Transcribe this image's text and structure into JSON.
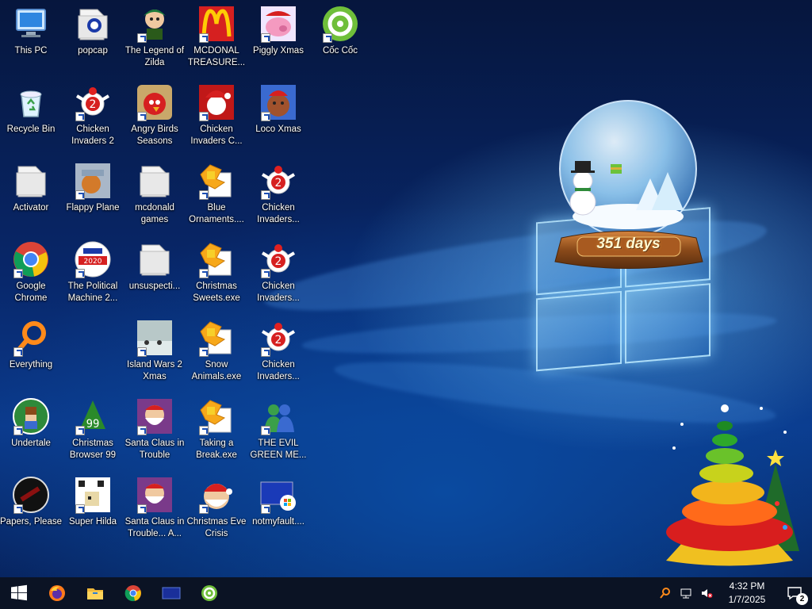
{
  "desktop": {
    "icons": [
      {
        "label": "This PC",
        "icon": "this-pc-icon",
        "shortcut": false
      },
      {
        "label": "Recycle Bin",
        "icon": "recycle-bin-icon",
        "shortcut": false
      },
      {
        "label": "Activator",
        "icon": "folder-icon",
        "shortcut": false
      },
      {
        "label": "Google Chrome",
        "icon": "chrome-icon",
        "shortcut": true
      },
      {
        "label": "Everything",
        "icon": "everything-search-icon",
        "shortcut": true
      },
      {
        "label": "Undertale",
        "icon": "undertale-icon",
        "shortcut": true
      },
      {
        "label": "Papers, Please",
        "icon": "papers-please-icon",
        "shortcut": true
      },
      {
        "label": "popcap",
        "icon": "popcap-folder-icon",
        "shortcut": false
      },
      {
        "label": "Chicken Invaders 2",
        "icon": "chicken-invaders-icon",
        "shortcut": true
      },
      {
        "label": "Flappy Plane",
        "icon": "flappy-plane-icon",
        "shortcut": true
      },
      {
        "label": "The Political Machine 2...",
        "icon": "political-machine-icon",
        "shortcut": true
      },
      {
        "label": "Christmas Browser 99",
        "icon": "christmas-browser-icon",
        "shortcut": true
      },
      {
        "label": "Super Hilda",
        "icon": "super-hilda-icon",
        "shortcut": true
      },
      {
        "label": "The Legend of Zilda",
        "icon": "legend-of-zilda-icon",
        "shortcut": true
      },
      {
        "label": "Angry Birds Seasons",
        "icon": "angry-birds-icon",
        "shortcut": true
      },
      {
        "label": "mcdonald games",
        "icon": "folder-icon",
        "shortcut": false
      },
      {
        "label": "unsuspecti...",
        "icon": "folder-icon",
        "shortcut": false
      },
      {
        "label": "Island Wars 2 Xmas",
        "icon": "island-wars-icon",
        "shortcut": true
      },
      {
        "label": "Santa Claus in Trouble",
        "icon": "santa-claus-icon",
        "shortcut": true
      },
      {
        "label": "Santa Claus in Trouble... A...",
        "icon": "santa-claus-icon",
        "shortcut": true
      },
      {
        "label": "MCDONAL TREASURE...",
        "icon": "mcdonalds-icon",
        "shortcut": true
      },
      {
        "label": "Chicken Invaders C...",
        "icon": "chicken-invaders-xmas-icon",
        "shortcut": true
      },
      {
        "label": "Blue Ornaments....",
        "icon": "puzzle-exe-icon",
        "shortcut": true
      },
      {
        "label": "Christmas Sweets.exe",
        "icon": "puzzle-exe-icon",
        "shortcut": true
      },
      {
        "label": "Snow Animals.exe",
        "icon": "puzzle-exe-icon",
        "shortcut": true
      },
      {
        "label": "Taking a Break.exe",
        "icon": "puzzle-exe-icon",
        "shortcut": true
      },
      {
        "label": "Christmas Eve Crisis",
        "icon": "santa-face-icon",
        "shortcut": true
      },
      {
        "label": "Piggly Xmas",
        "icon": "piggly-icon",
        "shortcut": true
      },
      {
        "label": "Loco Xmas",
        "icon": "loco-xmas-icon",
        "shortcut": true
      },
      {
        "label": "Chicken Invaders...",
        "icon": "chicken-invaders-icon",
        "shortcut": true
      },
      {
        "label": "Chicken Invaders...",
        "icon": "chicken-invaders-icon",
        "shortcut": true
      },
      {
        "label": "Chicken Invaders...",
        "icon": "chicken-invaders-icon",
        "shortcut": true
      },
      {
        "label": "THE EVIL GREEN ME...",
        "icon": "messenger-icon",
        "shortcut": true
      },
      {
        "label": "notmyfault....",
        "icon": "notmyfault-icon",
        "shortcut": true
      },
      {
        "label": "Cốc Cốc",
        "icon": "coc-coc-icon",
        "shortcut": true
      }
    ]
  },
  "widget": {
    "countdown": "351 days"
  },
  "taskbar": {
    "pinned": [
      {
        "name": "start-button",
        "icon": "windows-icon"
      },
      {
        "name": "firefox-button",
        "icon": "firefox-icon"
      },
      {
        "name": "file-explorer-button",
        "icon": "folder-icon"
      },
      {
        "name": "chrome-button",
        "icon": "chrome-icon"
      },
      {
        "name": "window-button",
        "icon": "window-icon"
      },
      {
        "name": "coc-coc-button",
        "icon": "coc-coc-icon"
      }
    ],
    "time": "4:32 PM",
    "date": "1/7/2025",
    "notification_count": "2"
  },
  "colors": {
    "taskbar": "#0b1324",
    "wallpaper_dark": "#06163d",
    "wallpaper_light": "#6ec8ff"
  }
}
